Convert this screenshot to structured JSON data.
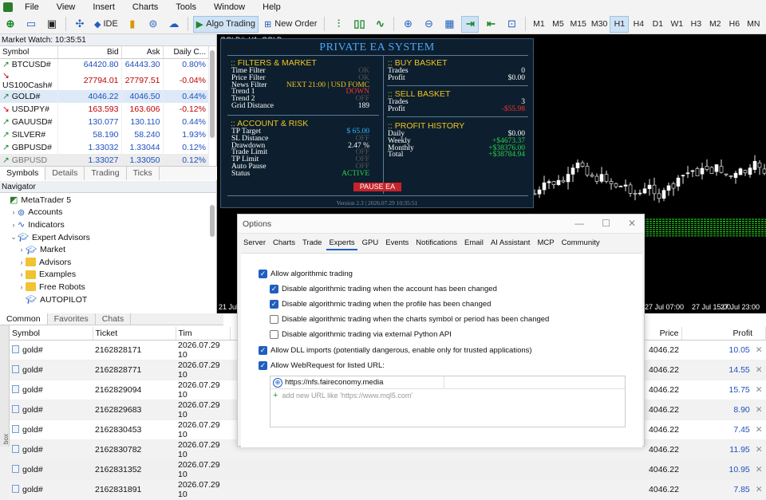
{
  "menu": [
    "File",
    "View",
    "Insert",
    "Charts",
    "Tools",
    "Window",
    "Help"
  ],
  "toolbar": {
    "ide_label": "IDE",
    "algo_label": "Algo Trading",
    "neworder_label": "New Order",
    "timeframes": [
      "M1",
      "M5",
      "M15",
      "M30",
      "H1",
      "H4",
      "D1",
      "W1",
      "H3",
      "M2",
      "H6",
      "MN"
    ],
    "selected_tf": "H1"
  },
  "market_watch": {
    "title": "Market Watch: 10:35:51",
    "headers": [
      "Symbol",
      "Bid",
      "Ask",
      "Daily C..."
    ],
    "rows": [
      {
        "symbol": "BTCUSD#",
        "bid": "64420.80",
        "ask": "64443.30",
        "change": "0.80%",
        "dir": "up"
      },
      {
        "symbol": "US100Cash#",
        "bid": "27794.01",
        "ask": "27797.51",
        "change": "-0.04%",
        "dir": "down"
      },
      {
        "symbol": "GOLD#",
        "bid": "4046.22",
        "ask": "4046.50",
        "change": "0.44%",
        "dir": "up"
      },
      {
        "symbol": "USDJPY#",
        "bid": "163.593",
        "ask": "163.606",
        "change": "-0.12%",
        "dir": "down"
      },
      {
        "symbol": "GAUUSD#",
        "bid": "130.077",
        "ask": "130.110",
        "change": "0.44%",
        "dir": "up"
      },
      {
        "symbol": "SILVER#",
        "bid": "58.190",
        "ask": "58.240",
        "change": "1.93%",
        "dir": "up"
      },
      {
        "symbol": "GBPUSD#",
        "bid": "1.33032",
        "ask": "1.33044",
        "change": "0.12%",
        "dir": "up"
      },
      {
        "symbol": "GBPUSD",
        "bid": "1.33027",
        "ask": "1.33050",
        "change": "0.12%",
        "dir": "up"
      }
    ],
    "tabs": [
      "Symbols",
      "Details",
      "Trading",
      "Ticks"
    ]
  },
  "navigator": {
    "title": "Navigator",
    "items": [
      {
        "label": "MetaTrader 5",
        "indent": 0,
        "arrow": "",
        "icon": "mt5"
      },
      {
        "label": "Accounts",
        "indent": 1,
        "arrow": ">",
        "icon": "accounts"
      },
      {
        "label": "Indicators",
        "indent": 1,
        "arrow": ">",
        "icon": "indicators"
      },
      {
        "label": "Expert Advisors",
        "indent": 1,
        "arrow": "v",
        "icon": "experts"
      },
      {
        "label": "Market",
        "indent": 2,
        "arrow": ">",
        "icon": "cap"
      },
      {
        "label": "Advisors",
        "indent": 2,
        "arrow": ">",
        "icon": "folder"
      },
      {
        "label": "Examples",
        "indent": 2,
        "arrow": ">",
        "icon": "folder"
      },
      {
        "label": "Free Robots",
        "indent": 2,
        "arrow": ">",
        "icon": "folder"
      },
      {
        "label": "AUTOPILOT",
        "indent": 2,
        "arrow": "",
        "icon": "cap"
      }
    ]
  },
  "lower": {
    "tabs": [
      "Common",
      "Favorites",
      "Chats"
    ],
    "headers": [
      "Symbol",
      "Ticket",
      "Tim",
      "Price",
      "Profit"
    ],
    "rows": [
      {
        "symbol": "gold#",
        "ticket": "2162828171",
        "time": "2026.07.29 10",
        "price": "4046.22",
        "profit": "10.05"
      },
      {
        "symbol": "gold#",
        "ticket": "2162828771",
        "time": "2026.07.29 10",
        "price": "4046.22",
        "profit": "14.55"
      },
      {
        "symbol": "gold#",
        "ticket": "2162829094",
        "time": "2026.07.29 10",
        "price": "4046.22",
        "profit": "15.75"
      },
      {
        "symbol": "gold#",
        "ticket": "2162829683",
        "time": "2026.07.29 10",
        "price": "4046.22",
        "profit": "8.90"
      },
      {
        "symbol": "gold#",
        "ticket": "2162830453",
        "time": "2026.07.29 10",
        "price": "4046.22",
        "profit": "7.45"
      },
      {
        "symbol": "gold#",
        "ticket": "2162830782",
        "time": "2026.07.29 10",
        "price": "4046.22",
        "profit": "11.95"
      },
      {
        "symbol": "gold#",
        "ticket": "2162831352",
        "time": "2026.07.29 10",
        "price": "4046.22",
        "profit": "10.95"
      },
      {
        "symbol": "gold#",
        "ticket": "2162831891",
        "time": "2026.07.29 10",
        "price": "4046.22",
        "profit": "7.85"
      }
    ],
    "side_label": "box"
  },
  "chart": {
    "header": "GOLD#, H1: GOLD",
    "time_labels": [
      "21 Jul",
      "27 Jul 07:00",
      "27 Jul 15:00",
      "27 Jul 23:00"
    ]
  },
  "ea": {
    "title": "PRIVATE EA SYSTEM",
    "filters_title": ":: FILTERS & MARKET",
    "filters": [
      {
        "k": "Time Filter",
        "v": "OK",
        "c": "okc"
      },
      {
        "k": "Price Filter",
        "v": "OK",
        "c": "okc"
      },
      {
        "k": "News Filter",
        "v": "NEXT 21:00 | USD FOMC",
        "c": "yel"
      },
      {
        "k": "Trend 1",
        "v": "DOWN",
        "c": "red"
      },
      {
        "k": "Trend 2",
        "v": "OFF",
        "c": "okc"
      },
      {
        "k": "Grid Distance",
        "v": "189",
        "c": "wh"
      }
    ],
    "risk_title": ":: ACCOUNT & RISK",
    "risk": [
      {
        "k": "TP Target",
        "v": "$ 65.00",
        "c": "cy"
      },
      {
        "k": "SL Distance",
        "v": "OFF",
        "c": "okc"
      },
      {
        "k": "Drawdown",
        "v": "2.47 %",
        "c": "wh"
      },
      {
        "k": "Trade Limit",
        "v": "OFF",
        "c": "okc"
      },
      {
        "k": "TP Limit",
        "v": "OFF",
        "c": "okc"
      },
      {
        "k": "Auto Pause",
        "v": "OFF",
        "c": "okc"
      },
      {
        "k": "Status",
        "v": "ACTIVE",
        "c": "gr"
      }
    ],
    "buy_title": ":: BUY BASKET",
    "buy": [
      {
        "k": "Trades",
        "v": "0",
        "c": "wh"
      },
      {
        "k": "Profit",
        "v": "$0.00",
        "c": "wh"
      }
    ],
    "sell_title": ":: SELL BASKET",
    "sell": [
      {
        "k": "Trades",
        "v": "3",
        "c": "wh"
      },
      {
        "k": "Profit",
        "v": "-$55.98",
        "c": "red"
      }
    ],
    "hist_title": ":: PROFIT HISTORY",
    "hist": [
      {
        "k": "Daily",
        "v": "$0.00",
        "c": "wh"
      },
      {
        "k": "Weekly",
        "v": "+$4673.37",
        "c": "gr"
      },
      {
        "k": "Monthly",
        "v": "+$38376.00",
        "c": "gr"
      },
      {
        "k": "Total",
        "v": "+$38784.94",
        "c": "gr"
      }
    ],
    "pause_label": "PAUSE EA",
    "footer": "Version 2.3 | 2026.07.29 10:35:51"
  },
  "options": {
    "title": "Options",
    "tabs": [
      "Server",
      "Charts",
      "Trade",
      "Experts",
      "GPU",
      "Events",
      "Notifications",
      "Email",
      "AI Assistant",
      "MCP",
      "Community"
    ],
    "active_tab": "Experts",
    "checks": [
      {
        "label": "Allow algorithmic trading",
        "checked": true,
        "indent": 0
      },
      {
        "label": "Disable algorithmic trading when the account has been changed",
        "checked": true,
        "indent": 1
      },
      {
        "label": "Disable algorithmic trading when the profile has been changed",
        "checked": true,
        "indent": 1
      },
      {
        "label": "Disable algorithmic trading when the charts symbol or period has been changed",
        "checked": false,
        "indent": 1
      },
      {
        "label": "Disable algorithmic trading via external Python API",
        "checked": false,
        "indent": 1
      },
      {
        "label": "Allow DLL imports (potentially dangerous, enable only for trusted applications)",
        "checked": true,
        "indent": 0
      },
      {
        "label": "Allow WebRequest for listed URL:",
        "checked": true,
        "indent": 0
      }
    ],
    "url": "https://nfs.faireconomy.media",
    "url_placeholder": "add new URL like 'https://www.mql5.com'"
  },
  "colors": {
    "accent": "#1f5fbf",
    "up": "#1a8a2a",
    "down": "#c00000",
    "ea_title": "#4aa8ff",
    "ea_section": "#f0c420"
  }
}
